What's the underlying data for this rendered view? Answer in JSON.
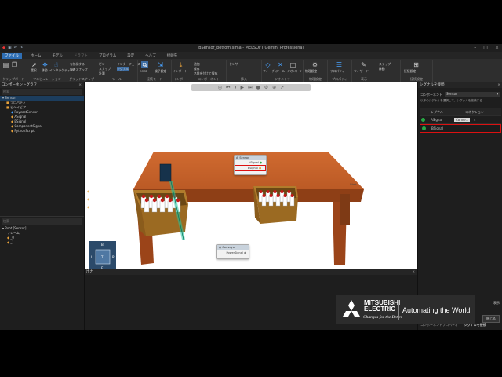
{
  "window": {
    "title": "BSensor_bottom.sima - MELSOFT Gemini Professional",
    "controls": [
      "minimize",
      "maximize",
      "close"
    ]
  },
  "menu": {
    "file": "ファイル",
    "items": [
      "ホーム",
      "モデル",
      "ドラフト",
      "プログラム",
      "設定",
      "ヘルプ",
      "接続先"
    ],
    "dim_item": "ドラフト"
  },
  "ribbon": {
    "groups": [
      {
        "label": "クリップボード"
      },
      {
        "label": "マニピュレーション"
      },
      {
        "label": "グリッドスナップ"
      },
      {
        "label": "ツール"
      },
      {
        "label": "接続モード"
      },
      {
        "label": "インポート"
      },
      {
        "label": "コンポーネント"
      },
      {
        "label": "挿入"
      },
      {
        "label": "ジオメトリ"
      },
      {
        "label": "物理設定"
      },
      {
        "label": "プロパティ"
      },
      {
        "label": "表示"
      },
      {
        "label": "接続設定"
      }
    ],
    "buttons": {
      "select": "選択",
      "move": "移動",
      "interactive": "インタラクティブ",
      "grid": "グリッド",
      "grid_enable": "有効化する",
      "snap": "吸着スナップ",
      "pin": "ピン",
      "snap2": "スナップ",
      "measure": "計測",
      "interface": "インターフェース",
      "signal": "シグナル",
      "ecat": "ECAT",
      "set_child": "親子設定",
      "import": "インポート",
      "add": "追加",
      "save": "保存",
      "save_as_comp": "名前を付けて保存",
      "sensor": "センサ",
      "feature": "フィーチャ",
      "tool": "ツール",
      "phys": "ジオメトリ",
      "physsettings": "物理設定",
      "prop": "プロパティ",
      "wizard": "ウィザード",
      "step": "ステップ",
      "move2": "移動",
      "conn": "接続設定"
    }
  },
  "component_graph": {
    "title": "コンポーネントグラフ",
    "search_placeholder": "検索",
    "tree": [
      {
        "label": "Sensor",
        "selected": true
      },
      {
        "label": "プロパティ"
      },
      {
        "label": "ビヘイビア"
      },
      {
        "label": "RaycastSensor"
      },
      {
        "label": "ASignal"
      },
      {
        "label": "BSignal"
      },
      {
        "label": "ComponentSignal"
      },
      {
        "label": "PythonScript"
      }
    ]
  },
  "lower_tree": {
    "search_placeholder": "検索",
    "tree": [
      {
        "label": "Root [Sensor]"
      },
      {
        "label": "フレーム"
      },
      {
        "label": "_0"
      },
      {
        "label": "_1"
      }
    ]
  },
  "viewport": {
    "toolbar_icons": [
      "camera-icon",
      "rewind-icon",
      "pause-icon",
      "play-icon",
      "step-icon",
      "record-icon",
      "gear-icon",
      "target-icon",
      "arrow-icon"
    ],
    "sensor_node": {
      "title": "Sensor",
      "ports": [
        "ASignal",
        "BSignal"
      ]
    },
    "conveyor_node": {
      "title": "Conveyor",
      "ports": [
        "PowerSignal"
      ]
    },
    "start_label": "Start",
    "navcube": {
      "top": "T",
      "left": "L",
      "right": "R",
      "bottom": "F",
      "back": "B"
    }
  },
  "output": {
    "title": "出力"
  },
  "right_panel": {
    "title": "シグナルを接続",
    "component_label": "コンポーネント",
    "component_value": "Sensor",
    "hint": "以下のシグナルを選択して、シグナルを接続する",
    "col_signal": "シグナル",
    "col_connection": "コネクション",
    "rows": [
      {
        "name": "ASignal",
        "connection": "Conve...",
        "color": "#28a745"
      },
      {
        "name": "BSignal",
        "connection": "",
        "color": "#28a745"
      }
    ],
    "buttons": {
      "close": "閉じる",
      "display": "表示"
    },
    "tabs": [
      "コンポーネントプロパティ",
      "シグナルを接続"
    ]
  },
  "branding": {
    "company": "MITSUBISHI ELECTRIC",
    "tagline": "Changes for the Better",
    "slogan": "Automating the World"
  },
  "colors": {
    "accent": "#2f6fb5",
    "table": "#c4622d",
    "crate": "#a9782a",
    "highlight": "#d11414"
  }
}
